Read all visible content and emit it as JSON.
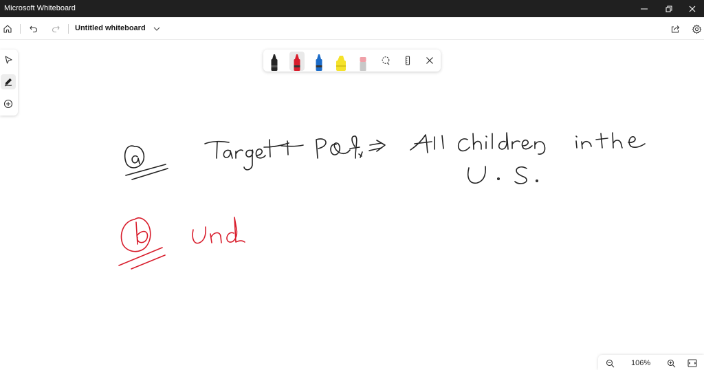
{
  "window": {
    "title": "Microsoft Whiteboard",
    "controls": [
      "minimize-icon",
      "restore-icon",
      "close-icon"
    ]
  },
  "toolbar": {
    "board_title": "Untitled whiteboard",
    "icons": [
      "home-icon",
      "undo-icon",
      "redo-icon",
      "chevron-down-icon",
      "share-icon",
      "settings-icon"
    ]
  },
  "left_rail": {
    "items": [
      {
        "name": "select",
        "icon": "pointer-icon",
        "active": false
      },
      {
        "name": "inking",
        "icon": "pen-icon",
        "active": true
      },
      {
        "name": "add",
        "icon": "plus-circle-icon",
        "active": false
      }
    ]
  },
  "pen_tray": {
    "pens": [
      {
        "name": "black-pen",
        "color": "#222222",
        "selected": false
      },
      {
        "name": "red-pen",
        "color": "#d81c2b",
        "selected": true
      },
      {
        "name": "blue-pen",
        "color": "#1b6bc8",
        "selected": false
      },
      {
        "name": "yellow-highlighter",
        "color": "#f5e22a",
        "selected": false
      },
      {
        "name": "eraser",
        "color": "#f0a0a8",
        "selected": false
      }
    ],
    "tools": [
      "lasso-icon",
      "ruler-icon",
      "close-icon"
    ]
  },
  "ink": {
    "black_color": "#222222",
    "red_color": "#d81c2b"
  },
  "zoom": {
    "level": "106%",
    "icons": [
      "zoom-out-icon",
      "zoom-in-icon",
      "fit-screen-icon"
    ]
  }
}
